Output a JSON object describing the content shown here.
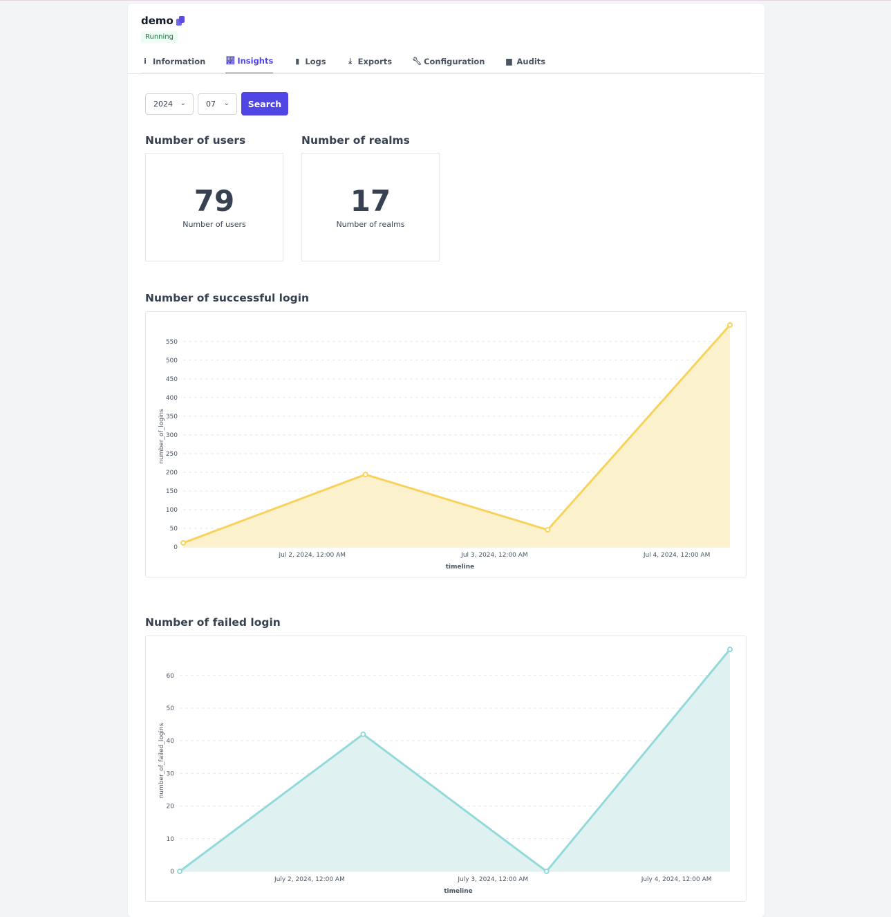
{
  "header": {
    "title": "demo",
    "status": "Running"
  },
  "tabs": [
    {
      "label": "Information",
      "icon": "info-icon"
    },
    {
      "label": "Insights",
      "icon": "chart-line-icon",
      "active": true
    },
    {
      "label": "Logs",
      "icon": "file-icon"
    },
    {
      "label": "Exports",
      "icon": "download-icon"
    },
    {
      "label": "Configuration",
      "icon": "wrench-icon"
    },
    {
      "label": "Audits",
      "icon": "calendar-icon"
    }
  ],
  "filters": {
    "year": "2024",
    "month": "07",
    "search_label": "Search"
  },
  "stats": [
    {
      "heading": "Number of users",
      "value": "79",
      "label": "Number of users"
    },
    {
      "heading": "Number of realms",
      "value": "17",
      "label": "Number of realms"
    }
  ],
  "colors": {
    "accent": "#4f46e5",
    "success_line": "#f7d35b",
    "success_fill": "#fcf1cd",
    "failed_line": "#94d9d9",
    "failed_fill": "#dff2f1"
  },
  "chart_data": [
    {
      "type": "area",
      "title": "Number of successful login",
      "xlabel": "timeline",
      "ylabel": "number_of_logins",
      "ylim": [
        0,
        594
      ],
      "yticks": [
        0,
        50,
        100,
        150,
        200,
        250,
        300,
        350,
        400,
        450,
        500,
        550
      ],
      "xticks": [
        {
          "x": "2024-07-02T00:00",
          "label": "Jul 2, 2024, 12:00 AM"
        },
        {
          "x": "2024-07-03T00:00",
          "label": "Jul 3, 2024, 12:00 AM"
        },
        {
          "x": "2024-07-04T00:00",
          "label": "Jul 4, 2024, 12:00 AM"
        }
      ],
      "x": [
        "2024-07-01T07:00",
        "2024-07-02T07:00",
        "2024-07-03T07:00",
        "2024-07-04T07:00"
      ],
      "values": [
        11,
        194,
        46,
        594
      ],
      "grid": true
    },
    {
      "type": "area",
      "title": "Number of failed login",
      "xlabel": "timeline",
      "ylabel": "number_of_failed_logins",
      "ylim": [
        0,
        68
      ],
      "yticks": [
        0,
        10,
        20,
        30,
        40,
        50,
        60
      ],
      "xticks": [
        {
          "x": "2024-07-02T00:00",
          "label": "July 2, 2024, 12:00 AM"
        },
        {
          "x": "2024-07-03T00:00",
          "label": "July 3, 2024, 12:00 AM"
        },
        {
          "x": "2024-07-04T00:00",
          "label": "July 4, 2024, 12:00 AM"
        }
      ],
      "x": [
        "2024-07-01T07:00",
        "2024-07-02T07:00",
        "2024-07-03T07:00",
        "2024-07-04T07:00"
      ],
      "values": [
        0,
        42,
        0,
        68
      ],
      "grid": true
    }
  ]
}
